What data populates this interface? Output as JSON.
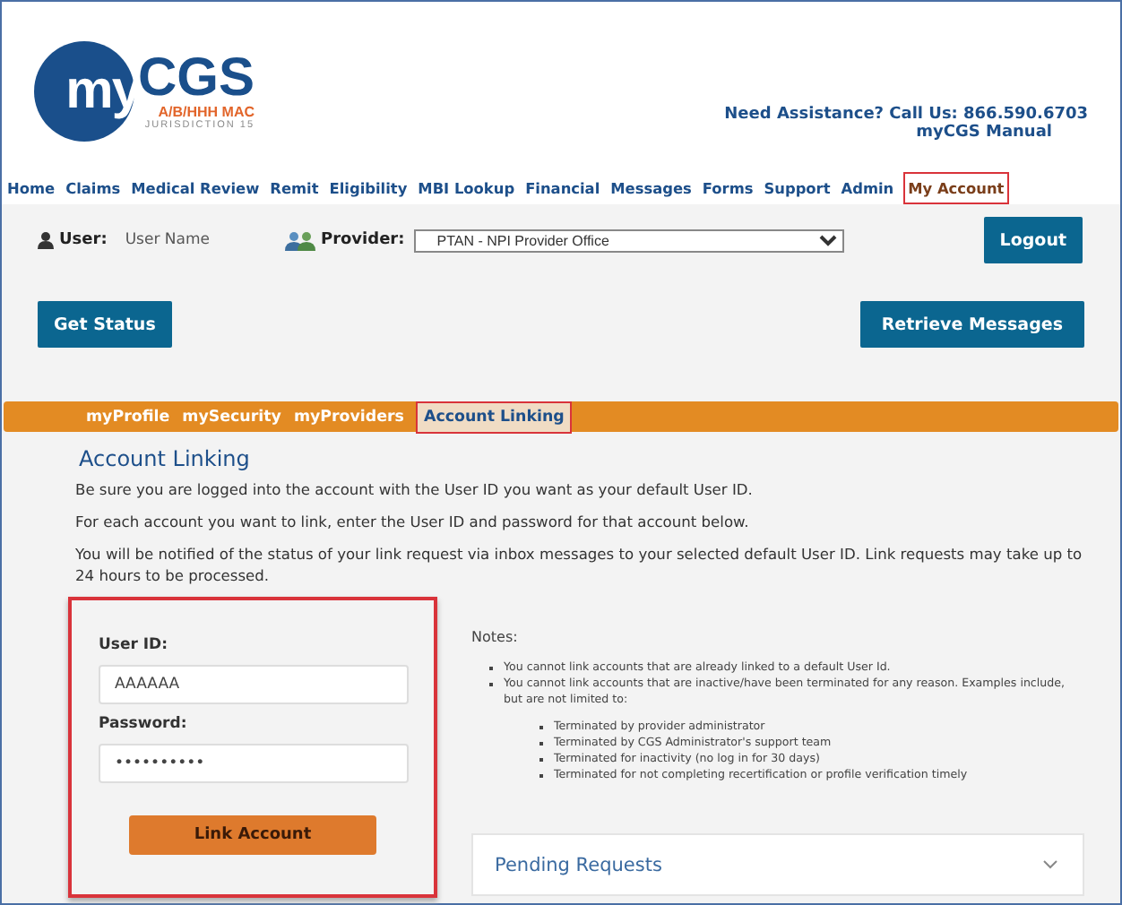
{
  "logo": {
    "brand_my": "my",
    "brand_cgs": "CGS",
    "subtitle": "A/B/HHH MAC",
    "jurisdiction": "JURISDICTION 15"
  },
  "assistance": {
    "text": "Need Assistance? Call Us: 866.590.6703",
    "manual_link": "myCGS Manual"
  },
  "nav": [
    {
      "label": "Home",
      "selected": false
    },
    {
      "label": "Claims",
      "selected": false
    },
    {
      "label": "Medical Review",
      "selected": false
    },
    {
      "label": "Remit",
      "selected": false
    },
    {
      "label": "Eligibility",
      "selected": false
    },
    {
      "label": "MBI Lookup",
      "selected": false
    },
    {
      "label": "Financial",
      "selected": false
    },
    {
      "label": "Messages",
      "selected": false
    },
    {
      "label": "Forms",
      "selected": false
    },
    {
      "label": "Support",
      "selected": false
    },
    {
      "label": "Admin",
      "selected": false
    },
    {
      "label": "My Account",
      "selected": true
    }
  ],
  "user": {
    "label": "User:",
    "value": "User Name"
  },
  "provider": {
    "label": "Provider:",
    "value": "PTAN - NPI     Provider Office"
  },
  "buttons": {
    "logout": "Logout",
    "get_status": "Get Status",
    "retrieve_messages": "Retrieve Messages"
  },
  "subnav": [
    {
      "label": "myProfile",
      "selected": false
    },
    {
      "label": "mySecurity",
      "selected": false
    },
    {
      "label": "myProviders",
      "selected": false
    },
    {
      "label": "Account Linking",
      "selected": true
    }
  ],
  "heading": "Account Linking",
  "paragraphs": [
    "Be sure you are logged into the account with the User ID you want as your default User ID.",
    "For each account you want to link, enter the User ID and password for that account below.",
    "You will be notified of the status of your link request via inbox messages to your selected default User ID. Link requests may take up to 24 hours to be processed."
  ],
  "form": {
    "user_id_label": "User ID:",
    "user_id_value": "AAAAAA",
    "password_label": "Password:",
    "password_value": "••••••••••",
    "submit": "Link Account"
  },
  "notes": {
    "title": "Notes:",
    "items": [
      {
        "text": "You cannot link accounts that are already linked to a default User Id."
      },
      {
        "text": "You cannot link accounts that are inactive/have been terminated for any reason. Examples include, but are not limited to:",
        "children": [
          {
            "text": "Terminated by provider administrator"
          },
          {
            "text": "Terminated by CGS Administrator's support team"
          },
          {
            "text": "Terminated for inactivity (no log in for 30 days)"
          },
          {
            "text": "Terminated for not completing recertification or profile verification timely"
          }
        ]
      }
    ]
  },
  "pending": {
    "title": "Pending Requests",
    "expanded": false
  }
}
